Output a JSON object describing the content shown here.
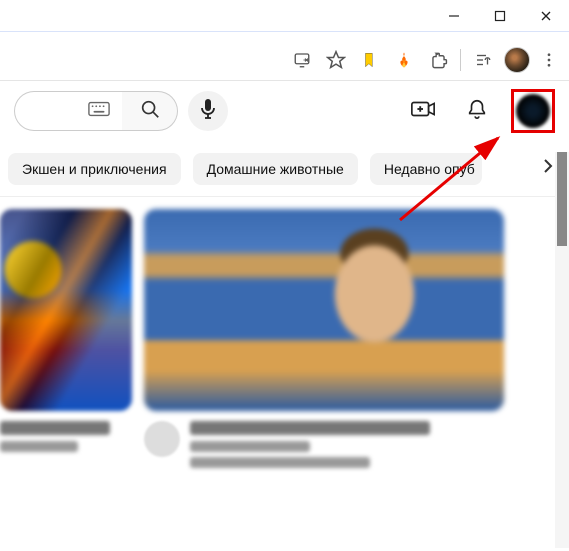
{
  "window_controls": {
    "minimize": "minimize",
    "maximize": "maximize",
    "close": "close"
  },
  "browser_toolbar": {
    "icons": [
      "cast",
      "star",
      "ext-yellow",
      "ext-flame",
      "extensions"
    ],
    "has_divider": true,
    "media_icon": "media-controls",
    "profile": "browser-profile-avatar",
    "menu": "kebab-menu"
  },
  "youtube_topbar": {
    "keyboard_tooltip_icon": "keyboard",
    "search_button": "search",
    "voice_button": "voice-search",
    "create_icon": "create-video",
    "notifications_icon": "notifications",
    "profile_icon": "account-avatar"
  },
  "chips": [
    {
      "label": "Экшен и приключения"
    },
    {
      "label": "Домашние животные"
    },
    {
      "label": "Недавно опуб"
    }
  ],
  "chips_next_aria": "next",
  "highlight": {
    "target": "account-avatar",
    "color": "#e60000"
  }
}
